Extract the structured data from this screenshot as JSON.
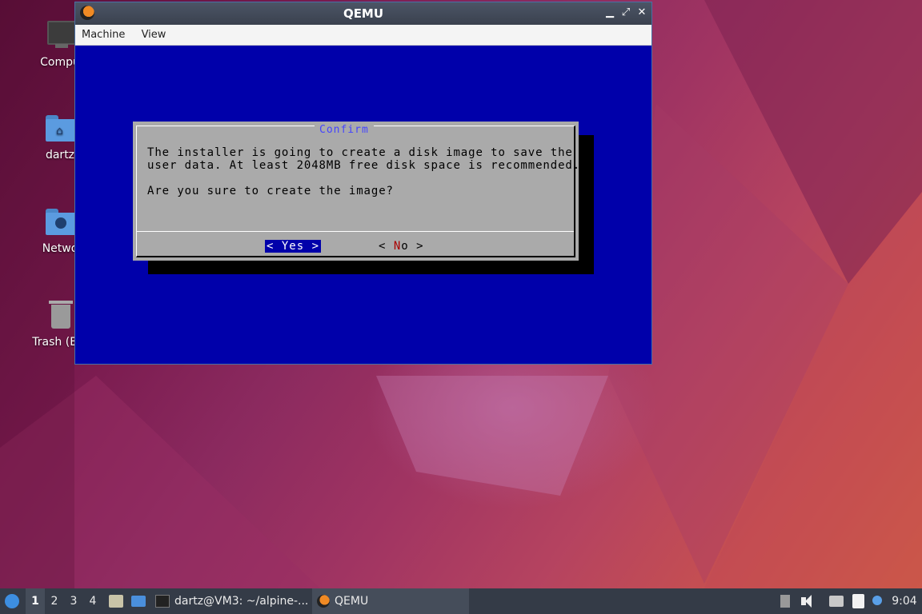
{
  "desktop": {
    "icons": [
      {
        "label": "Compu",
        "icon": "computer-icon"
      },
      {
        "label": "dartz",
        "icon": "home-folder-icon"
      },
      {
        "label": "Netwo",
        "icon": "network-folder-icon"
      },
      {
        "label": "Trash (Em",
        "icon": "trash-icon"
      }
    ]
  },
  "window": {
    "title": "QEMU",
    "menu": [
      "Machine",
      "View"
    ],
    "controls": {
      "minimize": "▁",
      "maximize": "⤢",
      "close": "✕"
    }
  },
  "dialog": {
    "title": "Confirm",
    "lines": [
      "The installer is going to create a disk image to save the",
      "user data. At least 2048MB free disk space is recommended.",
      "Are you sure to create the image?"
    ],
    "yes_label": "< Yes >",
    "no_open": "< ",
    "no_hot": "N",
    "no_rest": "o   >"
  },
  "taskbar": {
    "workspaces": [
      "1",
      "2",
      "3",
      "4"
    ],
    "tasks": [
      {
        "label": "dartz@VM3: ~/alpine-...",
        "icon": "terminal-icon"
      },
      {
        "label": "QEMU",
        "icon": "qemu-icon"
      }
    ],
    "clock": "9:04"
  },
  "colors": {
    "console_blue": "#0000aa",
    "dialog_gray": "#aaaaaa",
    "hotkey_red": "#aa0000",
    "title_blue": "#4444ff"
  }
}
